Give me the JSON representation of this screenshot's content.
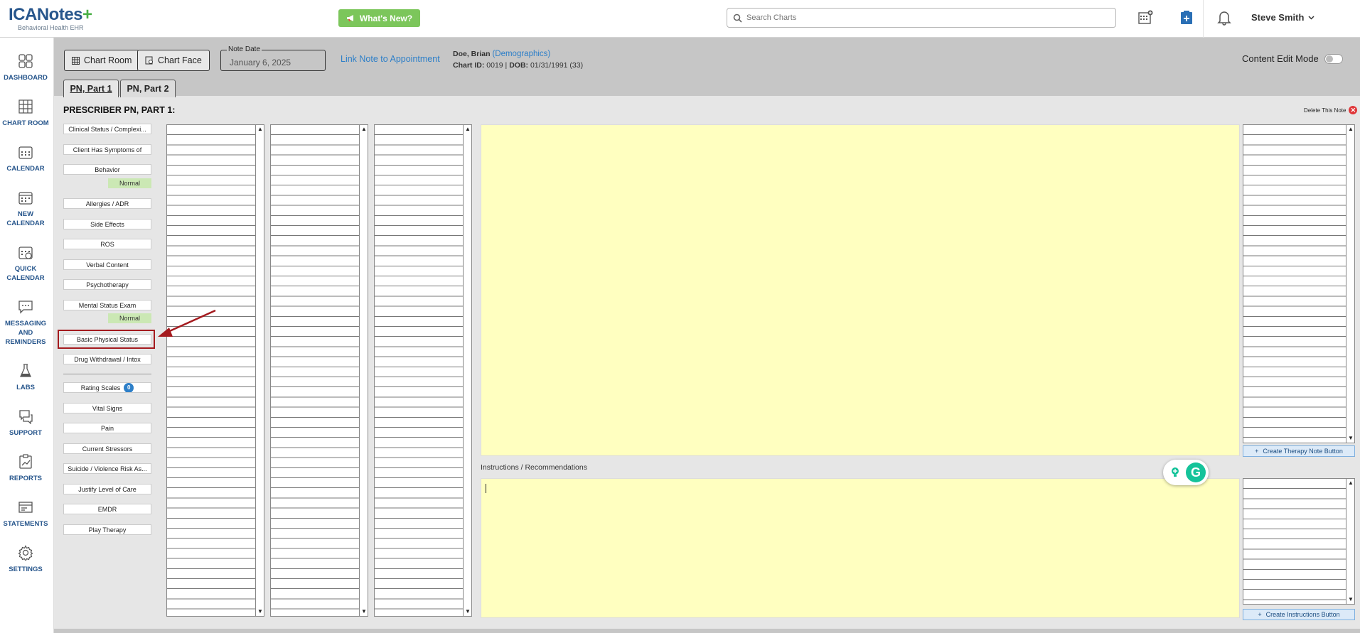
{
  "header": {
    "logo_text": "ICANotes",
    "logo_plus": "+",
    "logo_sub": "Behavioral Health EHR",
    "whats_new": "What's New?",
    "search_placeholder": "Search Charts",
    "user_name": "Steve Smith"
  },
  "sidebar": {
    "items": [
      {
        "label": "DASHBOARD"
      },
      {
        "label": "CHART ROOM"
      },
      {
        "label": "CALENDAR"
      },
      {
        "label": "NEW CALENDAR"
      },
      {
        "label": "QUICK CALENDAR"
      },
      {
        "label": "MESSAGING AND REMINDERS"
      },
      {
        "label": "LABS"
      },
      {
        "label": "SUPPORT"
      },
      {
        "label": "REPORTS"
      },
      {
        "label": "STATEMENTS"
      },
      {
        "label": "SETTINGS"
      }
    ]
  },
  "toolbar": {
    "chart_room": "Chart Room",
    "chart_face": "Chart Face",
    "note_date_label": "Note Date",
    "note_date_value": "January 6, 2025",
    "link_appointment": "Link Note to Appointment",
    "content_edit_mode": "Content Edit Mode"
  },
  "patient": {
    "name": "Doe, Brian",
    "demographics_link": "(Demographics)",
    "chart_id_label": "Chart ID:",
    "chart_id": "0019",
    "dob_label": "DOB:",
    "dob": "01/31/1991 (33)",
    "separator": "|"
  },
  "tabs": [
    {
      "label": "PN, Part 1",
      "active": true
    },
    {
      "label": "PN, Part 2",
      "active": false
    }
  ],
  "section": {
    "title": "PRESCRIBER PN, PART 1:",
    "delete_note": "Delete This Note"
  },
  "categories": [
    {
      "label": "Clinical Status / Complexi..."
    },
    {
      "label": "Client Has Symptoms of"
    },
    {
      "label": "Behavior"
    },
    {
      "label": "Normal"
    },
    {
      "label": "Allergies / ADR"
    },
    {
      "label": "Side Effects"
    },
    {
      "label": "ROS"
    },
    {
      "label": "Verbal Content"
    },
    {
      "label": "Psychotherapy"
    },
    {
      "label": "Mental Status Exam"
    },
    {
      "label": "Normal"
    },
    {
      "label": "Basic Physical Status"
    },
    {
      "label": "Drug Withdrawal / Intox"
    },
    {
      "label": "Rating Scales",
      "badge": "0"
    },
    {
      "label": "Vital Signs"
    },
    {
      "label": "Pain"
    },
    {
      "label": "Current Stressors"
    },
    {
      "label": "Suicide / Violence Risk As..."
    },
    {
      "label": "Justify Level of Care"
    },
    {
      "label": "EMDR"
    },
    {
      "label": "Play Therapy"
    }
  ],
  "note_area": {
    "instructions_label": "Instructions / Recommendations",
    "create_therapy_note": "Create Therapy Note Button",
    "create_instructions": "Create Instructions Button"
  },
  "colors": {
    "brand_blue": "#27568c",
    "brand_green": "#4ab046",
    "link_blue": "#2d7fc8",
    "note_yellow": "#ffffc0",
    "normal_green": "#cbe8b4",
    "highlight_red": "#a41a1e"
  },
  "icons": [
    "search-icon",
    "megaphone-icon",
    "calendar-add-icon",
    "chart-plus-icon",
    "bell-icon",
    "chevron-down-icon",
    "grammarly-icon"
  ]
}
